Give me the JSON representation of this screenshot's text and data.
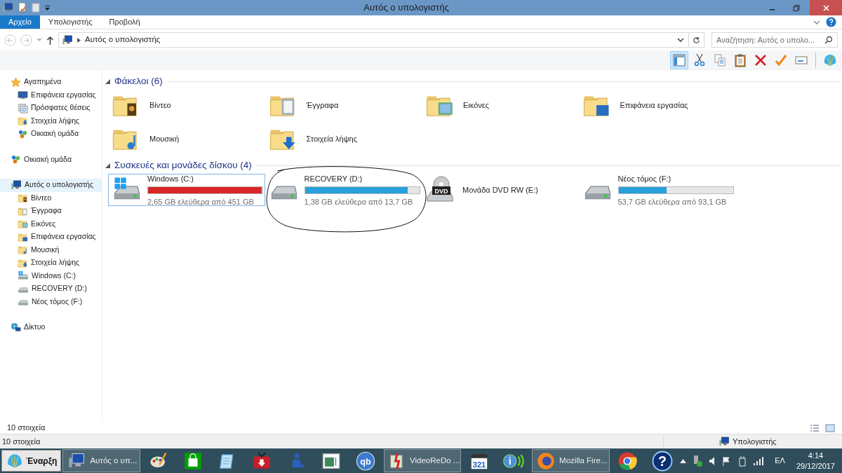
{
  "window": {
    "title": "Αυτός ο υπολογιστής"
  },
  "ribbon": {
    "tabs": [
      {
        "label": "Αρχείο",
        "selected": true
      },
      {
        "label": "Υπολογιστής",
        "selected": false
      },
      {
        "label": "Προβολή",
        "selected": false
      }
    ]
  },
  "address_bar": {
    "path": "Αυτός ο υπολογιστής",
    "search": {
      "placeholder": "Αναζήτηση: Αυτός ο υπολο..."
    }
  },
  "toolbar": [
    {
      "kind": "pane",
      "selected": true
    },
    {
      "kind": "cut",
      "selected": false
    },
    {
      "kind": "copy",
      "selected": false
    },
    {
      "kind": "paste",
      "selected": false
    },
    {
      "kind": "delete",
      "selected": false
    },
    {
      "kind": "check",
      "selected": false
    },
    {
      "kind": "rename",
      "selected": false
    },
    {
      "kind": "shell",
      "selected": false
    }
  ],
  "sidebar": {
    "items": [
      {
        "label": "Αγαπημένα",
        "kind": "favorites",
        "selected": false,
        "children": [
          {
            "label": "Επιφάνεια εργασίας",
            "kind": "desktop",
            "selected": false
          },
          {
            "label": "Πρόσφατες θέσεις",
            "kind": "recent",
            "selected": false
          },
          {
            "label": "Στοιχεία λήψης",
            "kind": "downloads",
            "selected": false
          },
          {
            "label": "Οικιακή ομάδα",
            "kind": "homegroup",
            "selected": false
          }
        ]
      },
      {
        "label": "Οικιακή ομάδα",
        "kind": "homegroup",
        "selected": false
      },
      {
        "label": "Αυτός ο υπολογιστής",
        "kind": "pc",
        "selected": true,
        "children": [
          {
            "label": "Βίντεο",
            "kind": "videos",
            "selected": false
          },
          {
            "label": "Έγγραφα",
            "kind": "documents",
            "selected": false
          },
          {
            "label": "Εικόνες",
            "kind": "pictures",
            "selected": false
          },
          {
            "label": "Επιφάνεια εργασίας",
            "kind": "desktop-folder",
            "selected": false
          },
          {
            "label": "Μουσική",
            "kind": "music",
            "selected": false
          },
          {
            "label": "Στοιχεία λήψης",
            "kind": "downloads",
            "selected": false
          },
          {
            "label": "Windows (C:)",
            "kind": "drive-windows",
            "selected": false
          },
          {
            "label": "RECOVERY (D:)",
            "kind": "drive",
            "selected": false
          },
          {
            "label": "Νέος τόμος (F:)",
            "kind": "drive",
            "selected": false
          }
        ]
      },
      {
        "label": "Δίκτυο",
        "kind": "network",
        "selected": false
      }
    ]
  },
  "content": {
    "sections": [
      {
        "title": "Φάκελοι (6)",
        "kind": "folders",
        "items": [
          {
            "label": "Βίντεο",
            "kind": "videos"
          },
          {
            "label": "Έγγραφα",
            "kind": "documents"
          },
          {
            "label": "Εικόνες",
            "kind": "pictures"
          },
          {
            "label": "Επιφάνεια εργασίας",
            "kind": "desktop-folder"
          },
          {
            "label": "Μουσική",
            "kind": "music"
          },
          {
            "label": "Στοιχεία λήψης",
            "kind": "downloads"
          }
        ]
      },
      {
        "title": "Συσκευές και μονάδες δίσκου (4)",
        "kind": "drives",
        "items": [
          {
            "label": "Windows (C:)",
            "kind": "drive-windows",
            "selected": true,
            "level": 0.994,
            "color": "#da2626",
            "free": "2,65 GB ελεύθερα από 451 GB"
          },
          {
            "label": "RECOVERY (D:)",
            "kind": "drive",
            "selected": false,
            "level": 0.9,
            "color": "#26a0da",
            "free": "1,38 GB ελεύθερα από 13,7 GB"
          },
          {
            "label": "Μονάδα DVD RW (E:)",
            "kind": "dvd",
            "selected": false,
            "icon_text": "DVD"
          },
          {
            "label": "Νέος τόμος (F:)",
            "kind": "drive",
            "selected": false,
            "level": 0.423,
            "color": "#26a0da",
            "free": "53,7 GB ελεύθερα από 93,1 GB"
          }
        ]
      }
    ]
  },
  "status_bar": {
    "count": "10 στοιχεία"
  },
  "outer_status_bar": {
    "count": "10 στοιχεία",
    "location": "Υπολογιστής"
  },
  "taskbar": {
    "start": "Έναρξη",
    "items": [
      {
        "kind": "explorer",
        "label": "Αυτός ο υπ..."
      },
      {
        "kind": "paint"
      },
      {
        "kind": "store"
      },
      {
        "kind": "notepad"
      },
      {
        "kind": "tv"
      },
      {
        "kind": "figure"
      },
      {
        "kind": "app-window"
      },
      {
        "kind": "qbittorrent",
        "icon_text": "qb"
      },
      {
        "kind": "videoredo",
        "label": "VideoReDo ..."
      },
      {
        "kind": "mpc",
        "icon_text": "321"
      },
      {
        "kind": "info",
        "icon_text": "i"
      },
      {
        "kind": "firefox",
        "label": "Mozilla Fire..."
      },
      {
        "kind": "chrome"
      },
      {
        "kind": "help",
        "icon_text": "?"
      }
    ],
    "language": "ΕΛ",
    "time": "4:14",
    "date": "29/12/2017"
  }
}
